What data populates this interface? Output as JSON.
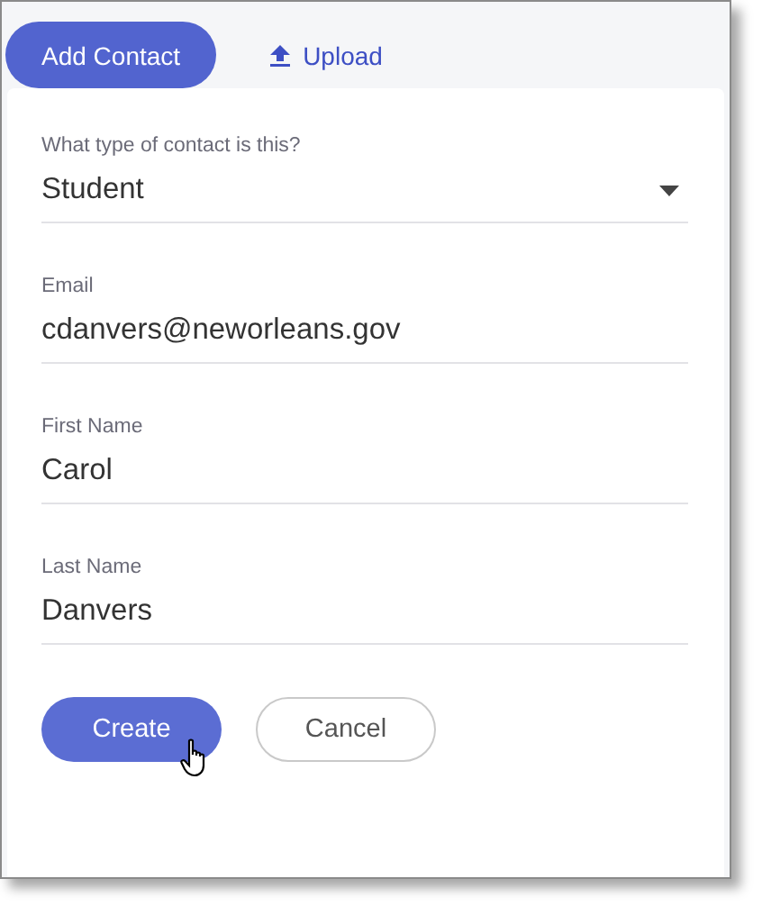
{
  "tabs": [
    {
      "label": "Add Contact",
      "selected": true,
      "kind": "text"
    },
    {
      "label": "Upload",
      "selected": false,
      "kind": "upload"
    }
  ],
  "fields": [
    {
      "label": "What type of contact is this?",
      "value": "Student",
      "kind": "select"
    },
    {
      "label": "Email",
      "value": "cdanvers@neworleans.gov",
      "kind": "text"
    },
    {
      "label": "First Name",
      "value": "Carol",
      "kind": "text"
    },
    {
      "label": "Last Name",
      "value": "Danvers",
      "kind": "text"
    }
  ],
  "buttons": [
    {
      "label": "Create",
      "kind": "primary",
      "hovered": true
    },
    {
      "label": "Cancel",
      "kind": "secondary",
      "hovered": false
    }
  ]
}
